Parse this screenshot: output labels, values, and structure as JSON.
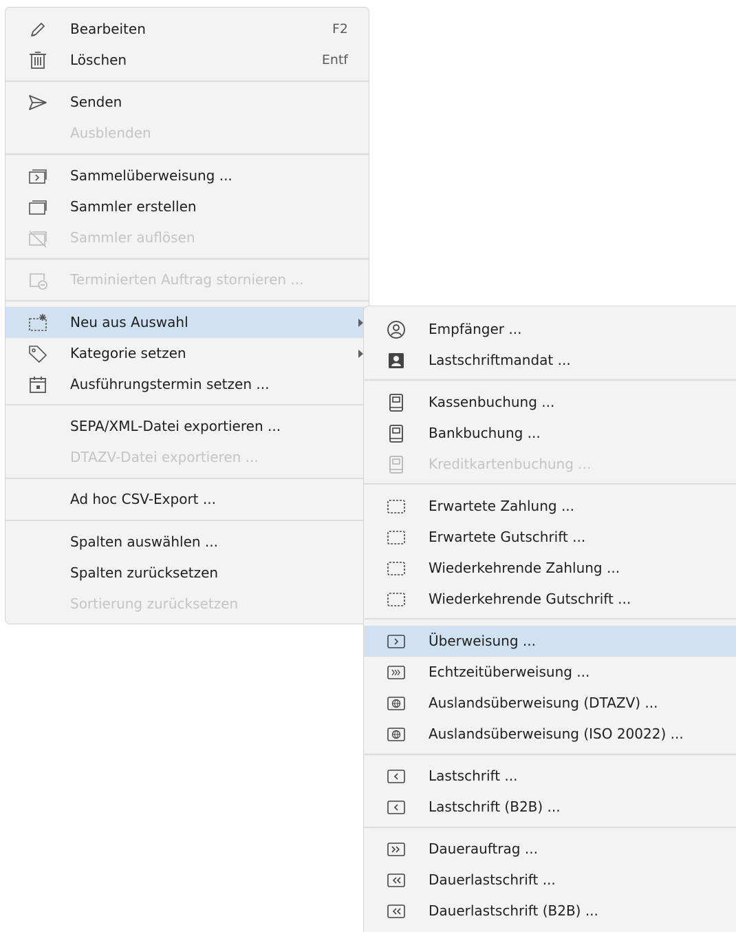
{
  "main_menu": {
    "edit_label": "Bearbeiten",
    "edit_shortcut": "F2",
    "delete_label": "Löschen",
    "delete_shortcut": "Entf",
    "send_label": "Senden",
    "hide_label": "Ausblenden",
    "batch_transfer_label": "Sammelüberweisung ...",
    "create_collector_label": "Sammler erstellen",
    "dissolve_collector_label": "Sammler auflösen",
    "cancel_scheduled_label": "Terminierten Auftrag stornieren ...",
    "new_from_selection_label": "Neu aus Auswahl",
    "set_category_label": "Kategorie setzen",
    "set_execution_date_label": "Ausführungstermin setzen ...",
    "export_sepa_label": "SEPA/XML-Datei exportieren ...",
    "export_dtazv_label": "DTAZV-Datei exportieren ...",
    "adhoc_csv_label": "Ad hoc CSV-Export ...",
    "select_columns_label": "Spalten auswählen ...",
    "reset_columns_label": "Spalten zurücksetzen",
    "reset_sorting_label": "Sortierung zurücksetzen"
  },
  "sub_menu": {
    "recipient_label": "Empfänger ...",
    "direct_debit_mandate_label": "Lastschriftmandat ...",
    "cash_booking_label": "Kassenbuchung ...",
    "bank_booking_label": "Bankbuchung ...",
    "credit_card_booking_label": "Kreditkartenbuchung ...",
    "expected_payment_label": "Erwartete Zahlung ...",
    "expected_credit_label": "Erwartete Gutschrift ...",
    "recurring_payment_label": "Wiederkehrende Zahlung ...",
    "recurring_credit_label": "Wiederkehrende Gutschrift ...",
    "transfer_label": "Überweisung ...",
    "instant_transfer_label": "Echtzeitüberweisung ...",
    "foreign_transfer_dtazv_label": "Auslandsüberweisung (DTAZV) ...",
    "foreign_transfer_iso_label": "Auslandsüberweisung (ISO 20022) ...",
    "direct_debit_label": "Lastschrift ...",
    "direct_debit_b2b_label": "Lastschrift (B2B) ...",
    "standing_order_label": "Dauerauftrag ...",
    "standing_debit_label": "Dauerlastschrift ...",
    "standing_debit_b2b_label": "Dauerlastschrift (B2B) ..."
  },
  "icons": {
    "edit": "pencil-icon",
    "delete": "trash-icon",
    "send": "send-icon",
    "batch_transfer": "batch-transfer-icon",
    "create_collector": "collector-icon",
    "dissolve_collector": "collector-off-icon",
    "cancel_scheduled": "cancel-scheduled-icon",
    "new_from_selection": "new-from-selection-icon",
    "set_category": "tag-icon",
    "set_execution_date": "calendar-icon"
  },
  "colors": {
    "menu_bg": "#f3f3f3",
    "highlight": "#d0e2f2",
    "disabled_text": "#c4c4c4"
  }
}
